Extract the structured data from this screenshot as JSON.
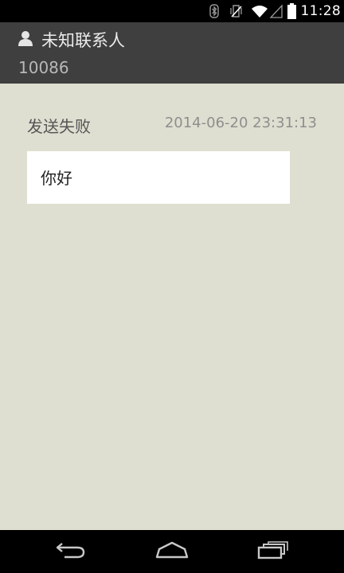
{
  "status_bar": {
    "time": "11:28",
    "icons": [
      "bluetooth-icon",
      "vibrate-icon",
      "wifi-icon",
      "signal-icon",
      "battery-icon"
    ]
  },
  "header": {
    "contact_name": "未知联系人",
    "phone_number": "10086",
    "contact_icon": "person-icon"
  },
  "message": {
    "status": "发送失败",
    "timestamp": "2014-06-20 23:31:13",
    "body": "你好"
  },
  "nav_bar": {
    "buttons": [
      "back-icon",
      "home-icon",
      "recents-icon"
    ]
  },
  "colors": {
    "header_bg": "#3f3f3f",
    "content_bg": "#dfdfd1",
    "bubble_bg": "#ffffff"
  }
}
